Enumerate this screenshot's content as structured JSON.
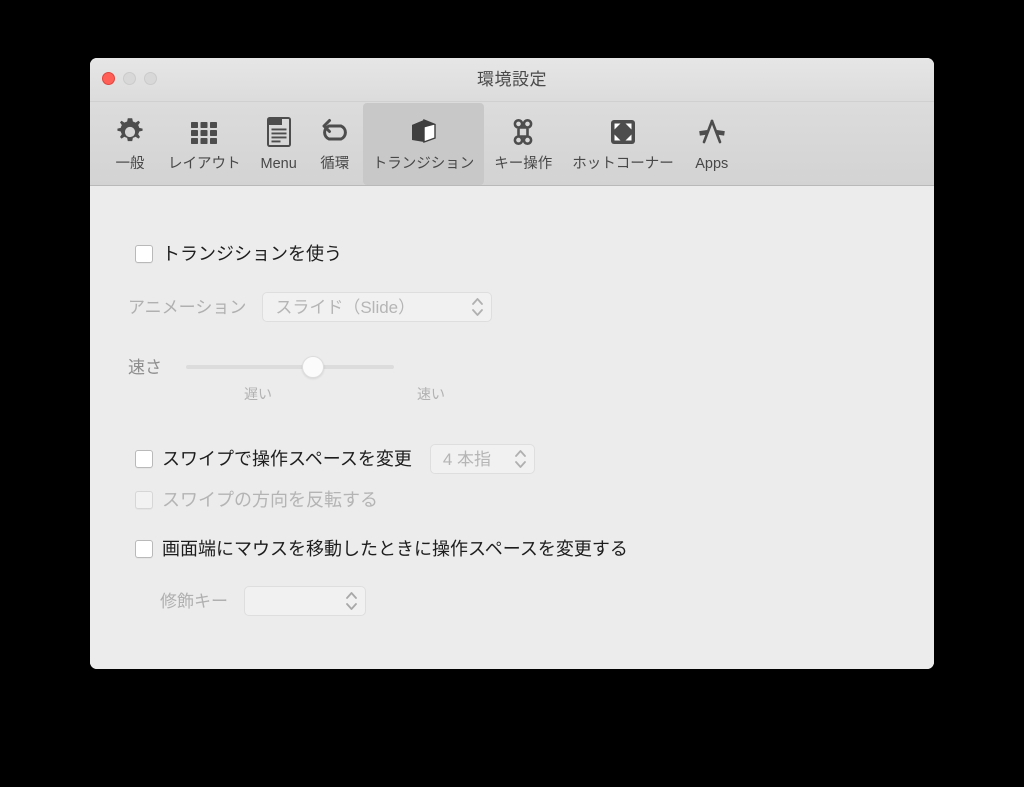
{
  "window": {
    "title": "環境設定",
    "traffic_lights": [
      {
        "name": "close",
        "color": "#ff5f57",
        "enabled": true
      },
      {
        "name": "minimize",
        "color": "#d8d8d8",
        "enabled": false
      },
      {
        "name": "zoom",
        "color": "#d8d8d8",
        "enabled": false
      }
    ]
  },
  "toolbar": {
    "items": [
      {
        "label": "一般",
        "icon": "gear-icon",
        "selected": false
      },
      {
        "label": "レイアウト",
        "icon": "grid-icon",
        "selected": false
      },
      {
        "label": "Menu",
        "icon": "document-icon",
        "selected": false
      },
      {
        "label": "循環",
        "icon": "loop-arrow-icon",
        "selected": false
      },
      {
        "label": "トランジション",
        "icon": "cube-icon",
        "selected": true
      },
      {
        "label": "キー操作",
        "icon": "command-key-icon",
        "selected": false
      },
      {
        "label": "ホットコーナー",
        "icon": "hot-corner-icon",
        "selected": false
      },
      {
        "label": "Apps",
        "icon": "app-store-icon",
        "selected": false
      }
    ]
  },
  "content": {
    "use_transition": {
      "label": "トランジションを使う",
      "checked": false,
      "enabled": true
    },
    "animation": {
      "label": "アニメーション",
      "value": "スライド（Slide）",
      "enabled": false
    },
    "speed": {
      "label": "速さ",
      "min_label": "遅い",
      "max_label": "速い",
      "value_percent": 61,
      "enabled": false
    },
    "swipe_change_space": {
      "label": "スワイプで操作スペースを変更",
      "checked": false,
      "enabled": true,
      "fingers_value": "4 本指",
      "fingers_enabled": false
    },
    "swipe_invert": {
      "label": "スワイプの方向を反転する",
      "checked": false,
      "enabled": false
    },
    "screen_edge_change_space": {
      "label": "画面端にマウスを移動したときに操作スペースを変更する",
      "checked": false,
      "enabled": true
    },
    "modifier_key": {
      "label": "修飾キー",
      "value": "",
      "enabled": false
    }
  },
  "colors": {
    "window_bg": "#ececec",
    "toolbar_bg": "#d6d6d6",
    "selected_tab_bg": "#c8c8c8",
    "icon_color": "#4d4d4d",
    "text_primary": "#1d1d1d",
    "text_disabled": "#b4b4b4",
    "close_button": "#ff5f57",
    "desktop_bg": "#000000"
  }
}
